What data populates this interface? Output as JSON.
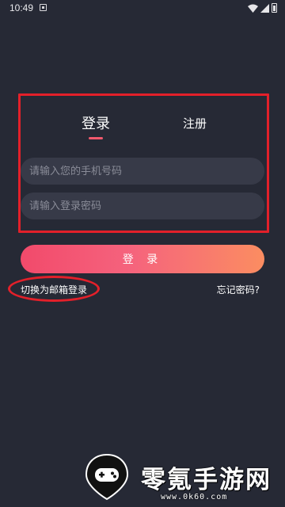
{
  "status_bar": {
    "time": "10:49",
    "icons": [
      "notification-icon",
      "wifi-icon",
      "signal-icon",
      "battery-icon"
    ]
  },
  "auth": {
    "tabs": [
      {
        "label": "登录",
        "active": true
      },
      {
        "label": "注册",
        "active": false
      }
    ],
    "phone_input": {
      "value": "",
      "placeholder": "请输入您的手机号码"
    },
    "password_input": {
      "value": "",
      "placeholder": "请输入登录密码"
    },
    "login_button": "登 录",
    "switch_link": "切换为邮箱登录",
    "forgot_link": "忘记密码?"
  },
  "watermark": {
    "title": "零氪手游网",
    "url": "www.0k60.com",
    "icon": "gamepad-pin-icon"
  },
  "colors": {
    "background": "#262935",
    "input_background": "#373a48",
    "accent": "#f1596d",
    "button_gradient_start": "#f24a6b",
    "button_gradient_end": "#fb8d61",
    "annotation_red": "#e3202a"
  }
}
